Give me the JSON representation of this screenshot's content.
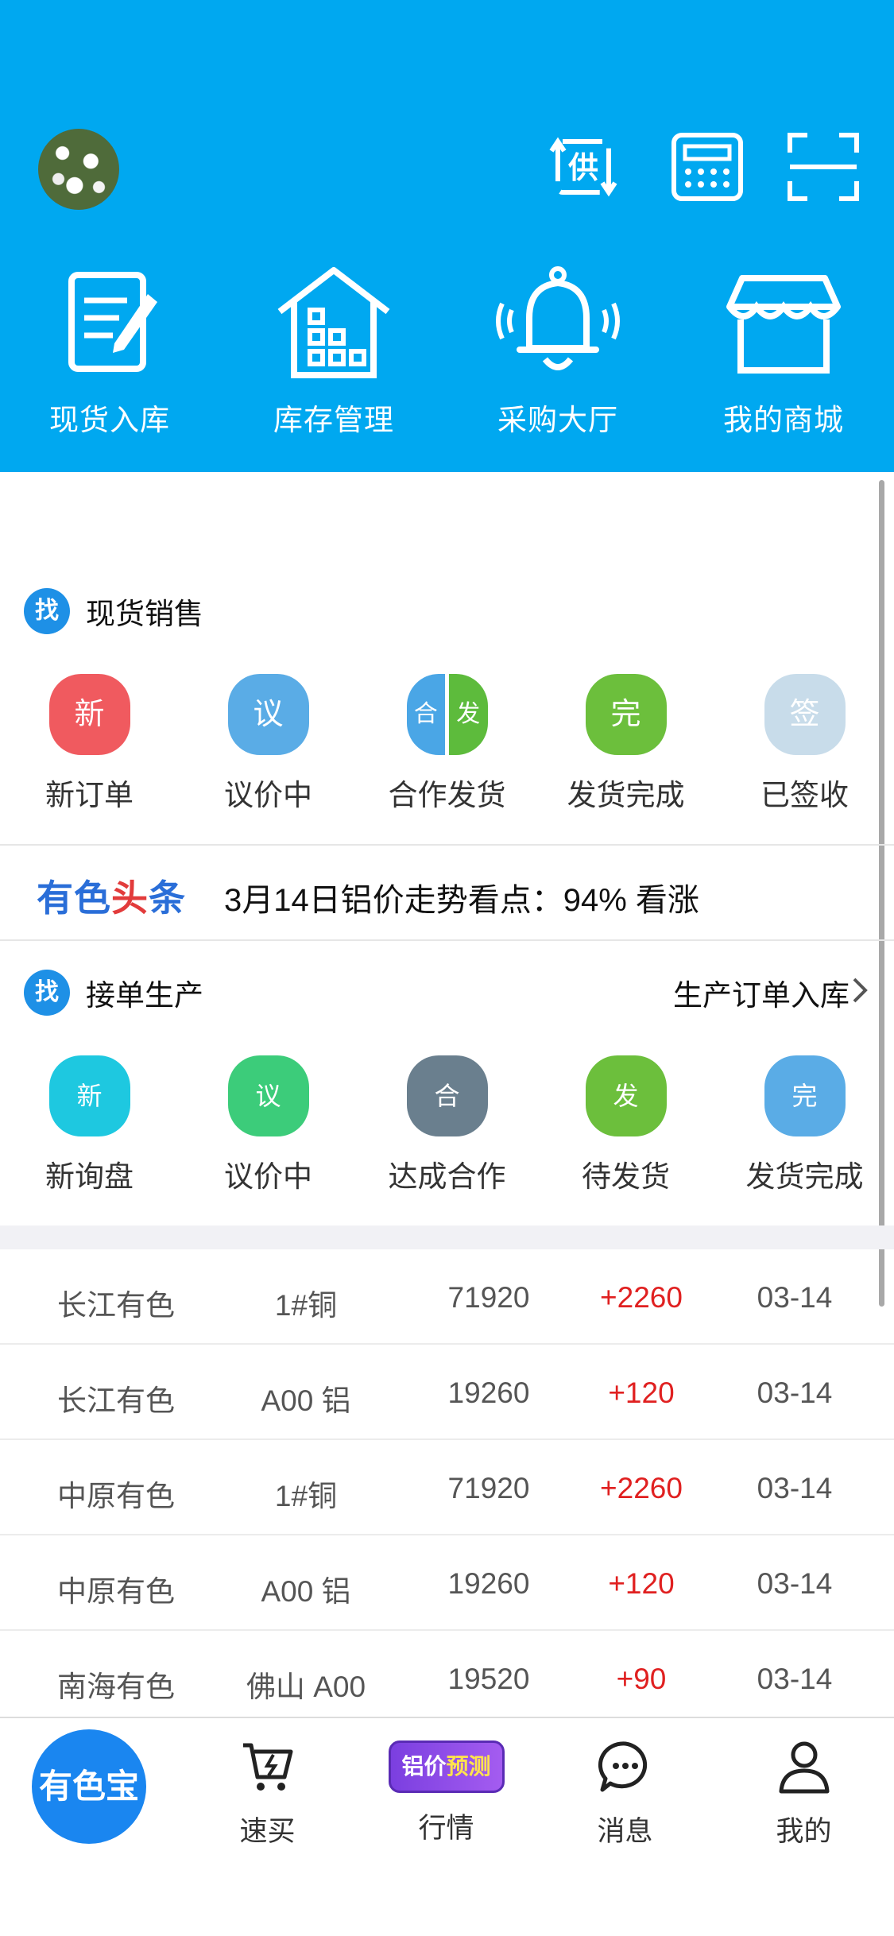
{
  "header": {
    "quick_nav": [
      {
        "label": "现货入库"
      },
      {
        "label": "库存管理"
      },
      {
        "label": "采购大厅"
      },
      {
        "label": "我的商城"
      }
    ],
    "supply_icon_glyph": "供"
  },
  "spot_sales": {
    "badge": "找",
    "title": "现货销售",
    "statuses": [
      {
        "icon_text": "新",
        "label": "新订单",
        "color": "#f05a5f"
      },
      {
        "icon_text": "议",
        "label": "议价中",
        "color": "#5aace6"
      },
      {
        "icon_text_left": "合",
        "icon_text_right": "发",
        "label": "合作发货",
        "color_left": "#4aa6e6",
        "color_right": "#5dbb3c"
      },
      {
        "icon_text": "完",
        "label": "发货完成",
        "color": "#6cbf3c"
      },
      {
        "icon_text": "签",
        "label": "已签收",
        "color": "#c8dcea"
      }
    ]
  },
  "news": {
    "logo_part1": "有色",
    "logo_part2": "头",
    "logo_part3": "条",
    "headline": "3月14日铝价走势看点：94% 看涨"
  },
  "production": {
    "badge": "找",
    "title": "接单生产",
    "link": "生产订单入库",
    "statuses": [
      {
        "icon_text": "新",
        "label": "新询盘",
        "color": "#1ec8e0"
      },
      {
        "icon_text": "议",
        "label": "议价中",
        "color": "#3ccc7a"
      },
      {
        "icon_text": "合",
        "label": "达成合作",
        "color": "#6a7f8e"
      },
      {
        "icon_text": "发",
        "label": "待发货",
        "color": "#6cbf3c"
      },
      {
        "icon_text": "完",
        "label": "发货完成",
        "color": "#5aace6"
      }
    ]
  },
  "prices": [
    {
      "market": "长江有色",
      "metal": "1#铜",
      "price": "71920",
      "change": "+2260",
      "date": "03-14"
    },
    {
      "market": "长江有色",
      "metal": "A00 铝",
      "price": "19260",
      "change": "+120",
      "date": "03-14"
    },
    {
      "market": "中原有色",
      "metal": "1#铜",
      "price": "71920",
      "change": "+2260",
      "date": "03-14"
    },
    {
      "market": "中原有色",
      "metal": "A00 铝",
      "price": "19260",
      "change": "+120",
      "date": "03-14"
    },
    {
      "market": "南海有色",
      "metal": "佛山 A00",
      "price": "19520",
      "change": "+90",
      "date": "03-14"
    }
  ],
  "tabbar": {
    "main_label": "有色宝",
    "tabs": [
      {
        "label": "速买",
        "icon": "cart-icon"
      },
      {
        "label": "行情",
        "icon": "promo-badge",
        "promo_part1": "铝价",
        "promo_part2": "预测"
      },
      {
        "label": "消息",
        "icon": "chat-icon"
      },
      {
        "label": "我的",
        "icon": "user-icon"
      }
    ]
  },
  "colors": {
    "header_bg": "#00a8f0",
    "price_change": "#e02020",
    "tab_main": "#1a86f0"
  }
}
